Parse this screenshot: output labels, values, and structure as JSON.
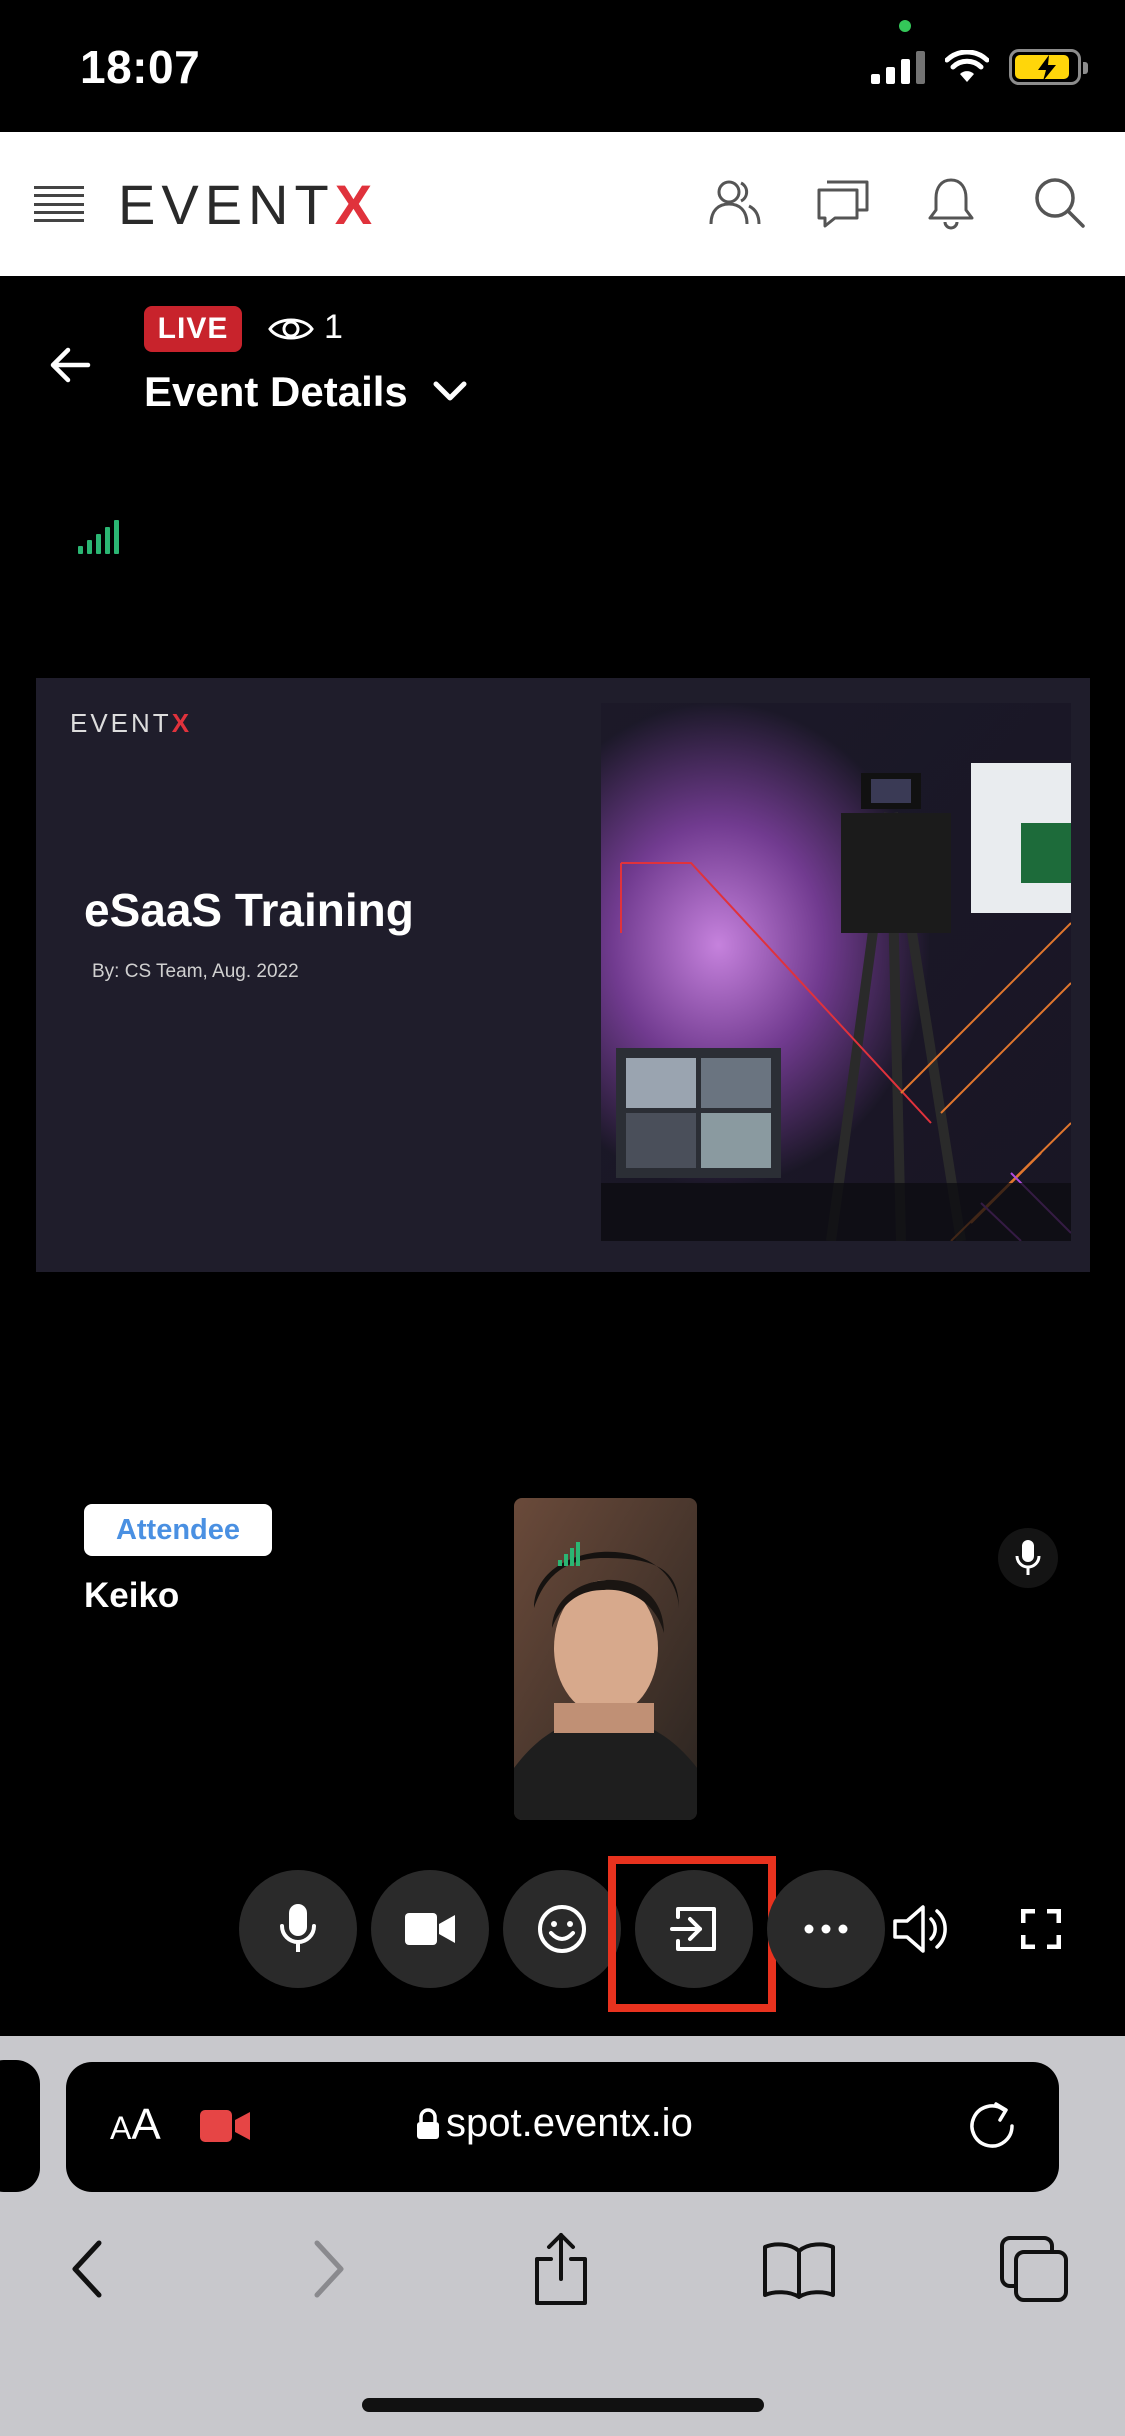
{
  "status_bar": {
    "time": "18:07"
  },
  "header": {
    "logo_main": "EVENT",
    "logo_x": "X"
  },
  "event": {
    "live_label": "LIVE",
    "viewer_count": "1",
    "title": "Event Details"
  },
  "slide": {
    "logo_main": "EVENT",
    "logo_x": "X",
    "title": "eSaaS Training",
    "subtitle": "By: CS Team, Aug. 2022"
  },
  "attendee": {
    "role": "Attendee",
    "name": "Keiko"
  },
  "controls": [
    "mic",
    "camera",
    "reactions",
    "leave",
    "more",
    "volume",
    "fullscreen"
  ],
  "browser": {
    "text_size_label_big": "A",
    "text_size_label_small": "A",
    "url": "spot.eventx.io"
  },
  "colors": {
    "live": "#c8232c",
    "brand_x": "#e0323c",
    "highlight": "#e8321e",
    "signal": "#2bb673"
  }
}
